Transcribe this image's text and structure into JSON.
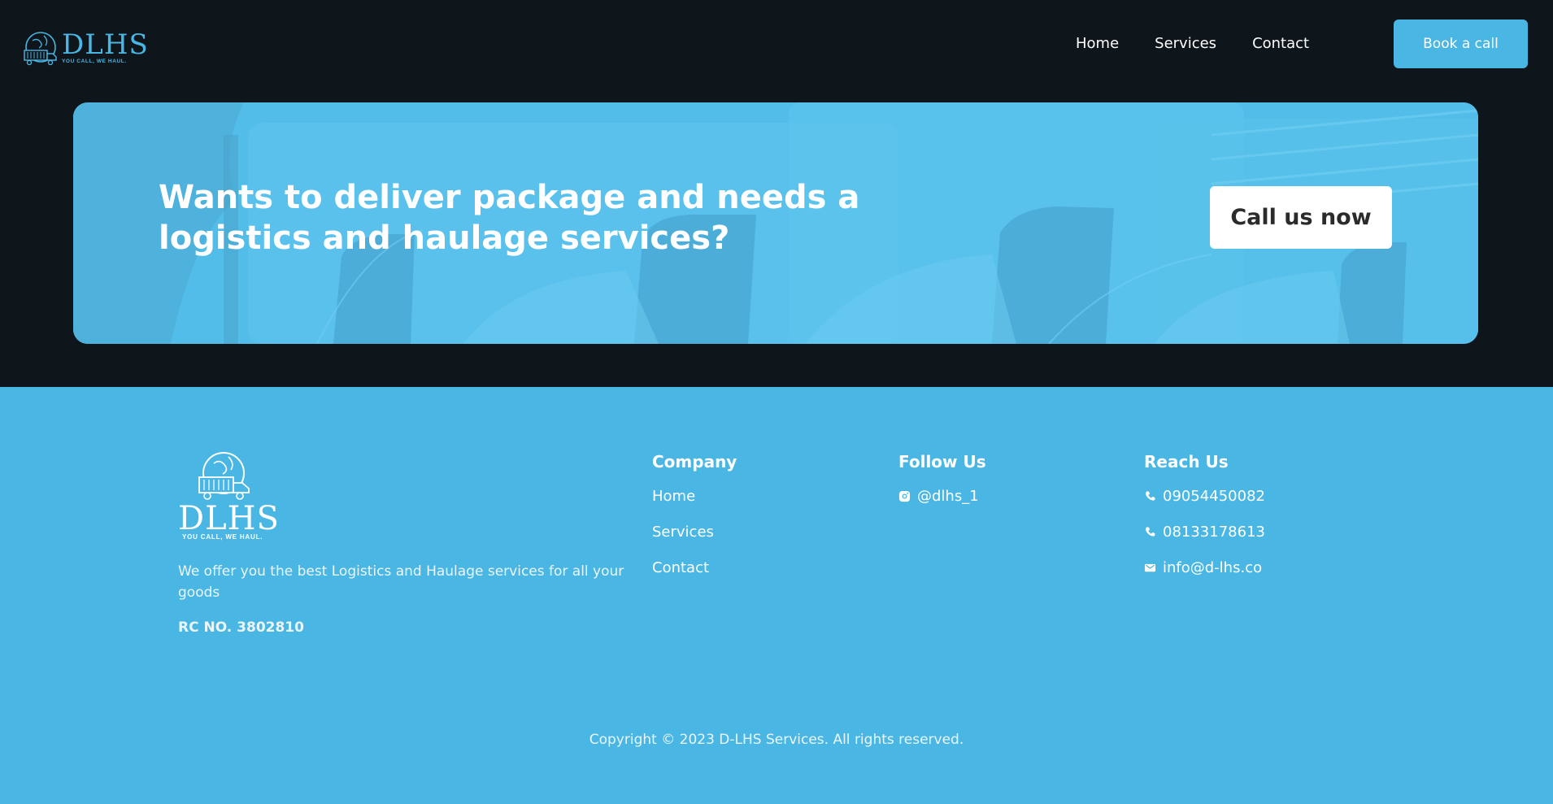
{
  "brand": {
    "logo_text": "DLHS",
    "tagline": "YOU CALL, WE HAUL.",
    "accent_color": "#4ab6e4",
    "dark_color": "#0f161b"
  },
  "nav": {
    "items": [
      {
        "label": "Home"
      },
      {
        "label": "Services"
      },
      {
        "label": "Contact"
      }
    ],
    "cta_label": "Book a call"
  },
  "cta": {
    "title_line1": "Wants to deliver package and needs a",
    "title_line2": "logistics and haulage services?",
    "button_label": "Call us now"
  },
  "footer": {
    "description": "We offer you the best Logistics and Haulage services for all your goods",
    "rc_number": "RC NO. 3802810",
    "company": {
      "title": "Company",
      "links": [
        {
          "label": "Home"
        },
        {
          "label": "Services"
        },
        {
          "label": "Contact"
        }
      ]
    },
    "follow": {
      "title": "Follow Us",
      "instagram": "@dlhs_1"
    },
    "reach": {
      "title": "Reach Us",
      "phone1": "09054450082",
      "phone2": "08133178613",
      "email": "info@d-lhs.co"
    },
    "copyright": "Copyright © 2023 D-LHS Services. All rights reserved."
  }
}
